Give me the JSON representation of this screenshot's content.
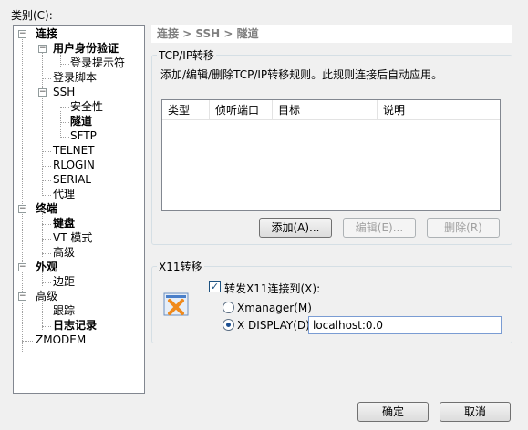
{
  "category_label": "类别(C):",
  "tree": [
    {
      "id": "connection",
      "label": "连接",
      "bold": true
    },
    {
      "id": "user-auth",
      "label": "用户身份验证",
      "bold": true
    },
    {
      "id": "login-prompt",
      "label": "登录提示符",
      "bold": false
    },
    {
      "id": "login-script",
      "label": "登录脚本",
      "bold": false
    },
    {
      "id": "ssh",
      "label": "SSH",
      "bold": false
    },
    {
      "id": "security",
      "label": "安全性",
      "bold": false
    },
    {
      "id": "tunnel",
      "label": "隧道",
      "bold": true
    },
    {
      "id": "sftp",
      "label": "SFTP",
      "bold": false
    },
    {
      "id": "telnet",
      "label": "TELNET",
      "bold": false
    },
    {
      "id": "rlogin",
      "label": "RLOGIN",
      "bold": false
    },
    {
      "id": "serial",
      "label": "SERIAL",
      "bold": false
    },
    {
      "id": "proxy",
      "label": "代理",
      "bold": false
    },
    {
      "id": "terminal",
      "label": "终端",
      "bold": true
    },
    {
      "id": "keyboard",
      "label": "键盘",
      "bold": true
    },
    {
      "id": "vt-mode",
      "label": "VT 模式",
      "bold": false
    },
    {
      "id": "advanced-terminal",
      "label": "高级",
      "bold": false
    },
    {
      "id": "appearance",
      "label": "外观",
      "bold": true
    },
    {
      "id": "margin",
      "label": "边距",
      "bold": false
    },
    {
      "id": "advanced",
      "label": "高级",
      "bold": false
    },
    {
      "id": "trace",
      "label": "跟踪",
      "bold": false
    },
    {
      "id": "logging",
      "label": "日志记录",
      "bold": true
    },
    {
      "id": "zmodem",
      "label": "ZMODEM",
      "bold": false
    }
  ],
  "breadcrumb": "连接 > SSH > 隧道",
  "tcp": {
    "title": "TCP/IP转移",
    "description": "添加/编辑/删除TCP/IP转移规则。此规则连接后自动应用。",
    "columns": [
      "类型",
      "侦听端口",
      "目标",
      "说明"
    ],
    "add_label": "添加(A)...",
    "edit_label": "编辑(E)...",
    "delete_label": "删除(R)"
  },
  "x11": {
    "title": "X11转移",
    "forward_label": "转发X11连接到(X):",
    "xmanager_label": "Xmanager(M)",
    "xdisplay_label": "X DISPLAY(D):",
    "display_value": "localhost:0.0"
  },
  "footer": {
    "ok_label": "确定",
    "cancel_label": "取消"
  }
}
